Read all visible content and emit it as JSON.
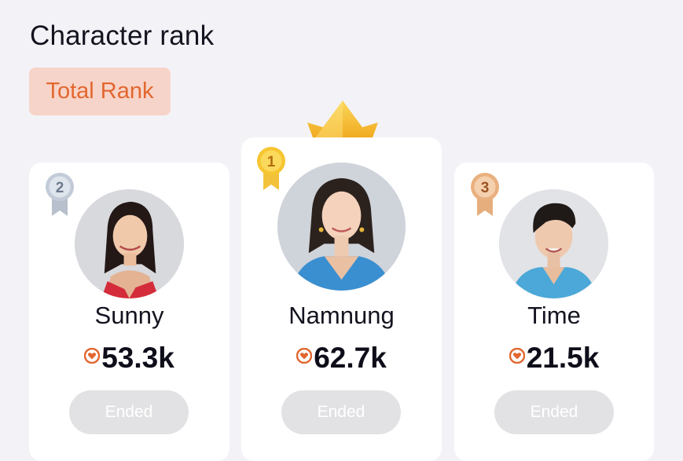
{
  "header": {
    "title": "Character rank"
  },
  "tabs": [
    {
      "label": "Total Rank",
      "active": true
    }
  ],
  "ranking": [
    {
      "rank": "2",
      "name": "Sunny",
      "score": "53.3k",
      "status": "Ended",
      "medal_color": "#aeb8c6",
      "avatar_bg": "#d8d9dd"
    },
    {
      "rank": "1",
      "name": "Namnung",
      "score": "62.7k",
      "status": "Ended",
      "medal_color": "#f0b92a",
      "avatar_bg": "#cfd3da"
    },
    {
      "rank": "3",
      "name": "Time",
      "score": "21.5k",
      "status": "Ended",
      "medal_color": "#e2a875",
      "avatar_bg": "#e2e3e6"
    }
  ],
  "icons": {
    "heart": "heart-icon",
    "crown": "crown-icon",
    "medal": "medal-icon"
  },
  "colors": {
    "accent": "#e2672f",
    "tab_bg": "#f7d4c9",
    "button_disabled": "#e2e2e5"
  }
}
